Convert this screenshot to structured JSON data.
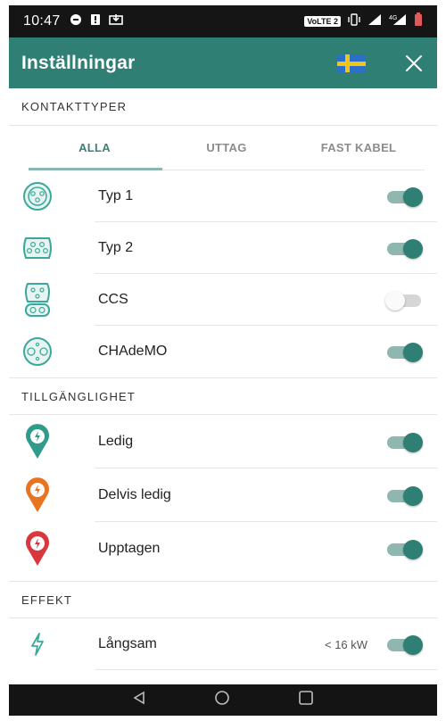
{
  "status_bar": {
    "time": "10:47",
    "network_badge": "VoLTE 2",
    "left_icons": [
      "chat-bubble-icon",
      "alert-icon",
      "download-icon"
    ],
    "right_icons": [
      "vibrate-icon",
      "signal-icon",
      "signal-4g-icon",
      "battery-icon"
    ]
  },
  "app_bar": {
    "title": "Inställningar",
    "flag": "swedish-flag-icon",
    "close": "close-icon"
  },
  "sections": {
    "contacts": {
      "title": "KONTAKTTYPER",
      "tabs": [
        {
          "label": "ALLA",
          "active": true
        },
        {
          "label": "UTTAG",
          "active": false
        },
        {
          "label": "FAST KABEL",
          "active": false
        }
      ],
      "items": [
        {
          "label": "Typ 1",
          "on": true
        },
        {
          "label": "Typ 2",
          "on": true
        },
        {
          "label": "CCS",
          "on": false
        },
        {
          "label": "CHAdeMO",
          "on": true
        }
      ]
    },
    "availability": {
      "title": "TILLGÄNGLIGHET",
      "items": [
        {
          "label": "Ledig",
          "color": "#2f9b8a",
          "on": true
        },
        {
          "label": "Delvis ledig",
          "color": "#e8741f",
          "on": true
        },
        {
          "label": "Upptagen",
          "color": "#d9363e",
          "on": true
        }
      ]
    },
    "effect": {
      "title": "EFFEKT",
      "items": [
        {
          "label": "Långsam",
          "extra": "< 16 kW",
          "on": true
        }
      ]
    }
  },
  "colors": {
    "accent": "#2f7f74",
    "statusbar": "#151515"
  }
}
